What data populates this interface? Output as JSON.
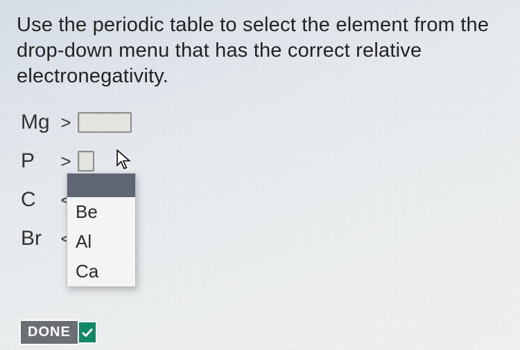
{
  "instructions": "Use the periodic table to select the element from the drop-down menu that has the correct relative electronegativity.",
  "rows": [
    {
      "element": "Mg",
      "op": ">"
    },
    {
      "element": "P",
      "op": ">"
    },
    {
      "element": "C",
      "op": "<"
    },
    {
      "element": "Br",
      "op": "<"
    }
  ],
  "dropdown_options": [
    "",
    "Be",
    "Al",
    "Ca"
  ],
  "done_label": "DONE",
  "icons": {
    "cursor": "cursor-icon",
    "check": "check-icon"
  },
  "colors": {
    "done_bg": "#6b6f73",
    "check_bg": "#0f8a62",
    "menu_highlight": "#5f6673"
  }
}
